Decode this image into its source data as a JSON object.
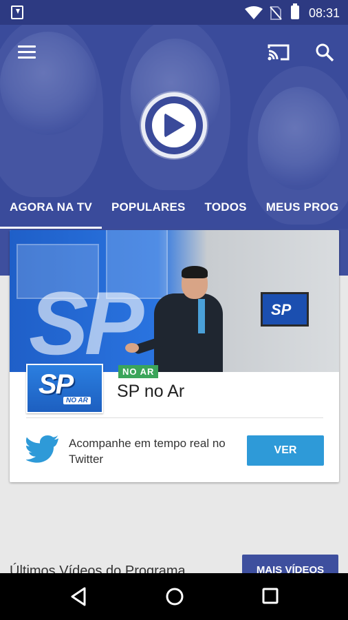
{
  "status_bar": {
    "time": "08:31",
    "icons": [
      "download-icon",
      "wifi-icon",
      "no-sim-icon",
      "battery-icon"
    ]
  },
  "header": {
    "menu_icon": "hamburger-menu-icon",
    "cast_icon": "cast-icon",
    "search_icon": "search-icon",
    "logo": "record-logo"
  },
  "tabs": [
    {
      "label": "AGORA NA TV",
      "active": true
    },
    {
      "label": "POPULARES",
      "active": false
    },
    {
      "label": "TODOS",
      "active": false
    },
    {
      "label": "MEUS PROG",
      "active": false
    }
  ],
  "card": {
    "thumbnail": {
      "title": "SP",
      "subtitle": "NO AR"
    },
    "badge": "NO AR",
    "program_title": "SP no Ar",
    "twitter_text": "Acompanhe em tempo real no Twitter",
    "ver_button": "VER",
    "image_text": "SP",
    "monitor_text": "SP"
  },
  "videos": {
    "title": "Últimos Vídeos do Programa",
    "more_button": "MAIS VÍDEOS"
  },
  "nav_bar": {
    "icons": [
      "back-icon",
      "home-icon",
      "recent-apps-icon"
    ]
  },
  "colors": {
    "primary": "#3e4f9e",
    "accent": "#2e9ad8",
    "live_badge": "#3ba55a"
  }
}
